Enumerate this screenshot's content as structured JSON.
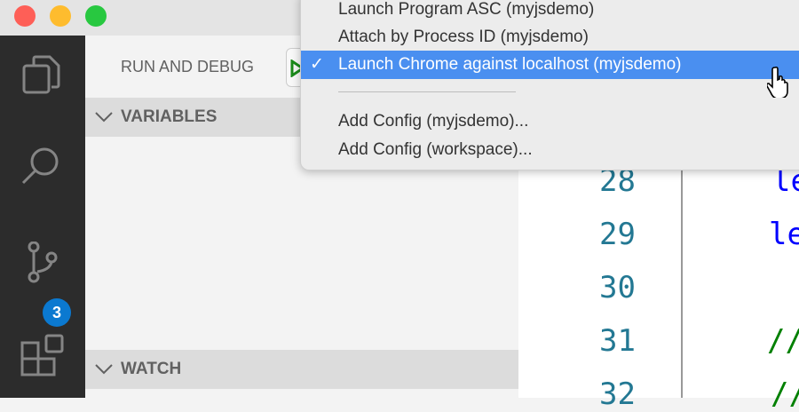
{
  "window": {
    "controls": {
      "close_color": "#fe5f57",
      "minimize_color": "#febc2e",
      "maximize_color": "#28c840"
    }
  },
  "activity_bar": {
    "items": [
      {
        "icon": "explorer-icon"
      },
      {
        "icon": "search-icon"
      },
      {
        "icon": "source-control-icon",
        "badge": "3"
      },
      {
        "icon": "extensions-icon"
      }
    ]
  },
  "sidebar": {
    "title": "RUN AND DEBUG",
    "sections": {
      "variables": "VARIABLES",
      "watch": "WATCH"
    }
  },
  "dropdown": {
    "items": [
      {
        "label": "Launch Program ASC (myjsdemo)",
        "selected": false
      },
      {
        "label": "Attach by Process ID (myjsdemo)",
        "selected": false
      },
      {
        "label": "Launch Chrome against localhost (myjsdemo)",
        "selected": true
      },
      {
        "label": "Add Config (myjsdemo)...",
        "selected": false
      },
      {
        "label": "Add Config (workspace)...",
        "selected": false
      }
    ],
    "check": "✓",
    "accent": "#4a8ff0"
  },
  "editor": {
    "lines": [
      {
        "number": "28",
        "code": "le",
        "color": "#0000ff"
      },
      {
        "number": "29",
        "code": "le",
        "color": "#0000ff"
      },
      {
        "number": "30",
        "code": "",
        "color": "#000000"
      },
      {
        "number": "31",
        "code": "//",
        "color": "#008000"
      },
      {
        "number": "32",
        "code": "//",
        "color": "#008000"
      }
    ]
  }
}
